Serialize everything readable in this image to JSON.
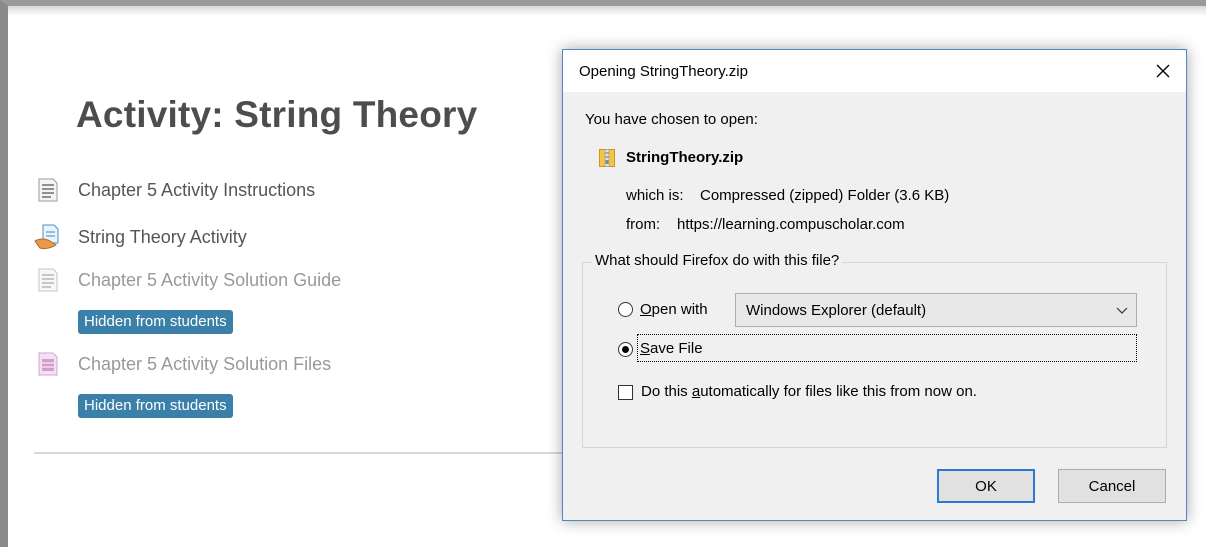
{
  "page": {
    "title": "Activity: String Theory",
    "items": [
      {
        "label": "Chapter 5 Activity Instructions",
        "icon": "document-icon"
      },
      {
        "label": "String Theory Activity",
        "icon": "assignment-icon"
      },
      {
        "label": "Chapter 5 Activity Solution Guide",
        "icon": "document-icon",
        "badge": "Hidden from students"
      },
      {
        "label": "Chapter 5 Activity Solution Files",
        "icon": "folder-file-icon",
        "badge": "Hidden from students"
      }
    ]
  },
  "dialog": {
    "title": "Opening StringTheory.zip",
    "intro": "You have chosen to open:",
    "filename": "StringTheory.zip",
    "which_is_label": "which is:",
    "which_is_value": "Compressed (zipped) Folder (3.6 KB)",
    "from_label": "from:",
    "from_value": "https://learning.compuscholar.com",
    "question": "What should Firefox do with this file?",
    "open_with_mnemonic": "O",
    "open_with_rest": "pen with",
    "open_with_app": "Windows Explorer (default)",
    "save_file_mnemonic": "S",
    "save_file_rest": "ave File",
    "auto_pre": "Do this ",
    "auto_mnemonic": "a",
    "auto_rest": "utomatically for files like this from now on.",
    "ok": "OK",
    "cancel": "Cancel",
    "selected_option": "save",
    "auto_checked": false
  },
  "colors": {
    "badge": "#3a80a8",
    "dialog_border": "#4a8ac7",
    "default_button_border": "#2b79d6"
  }
}
